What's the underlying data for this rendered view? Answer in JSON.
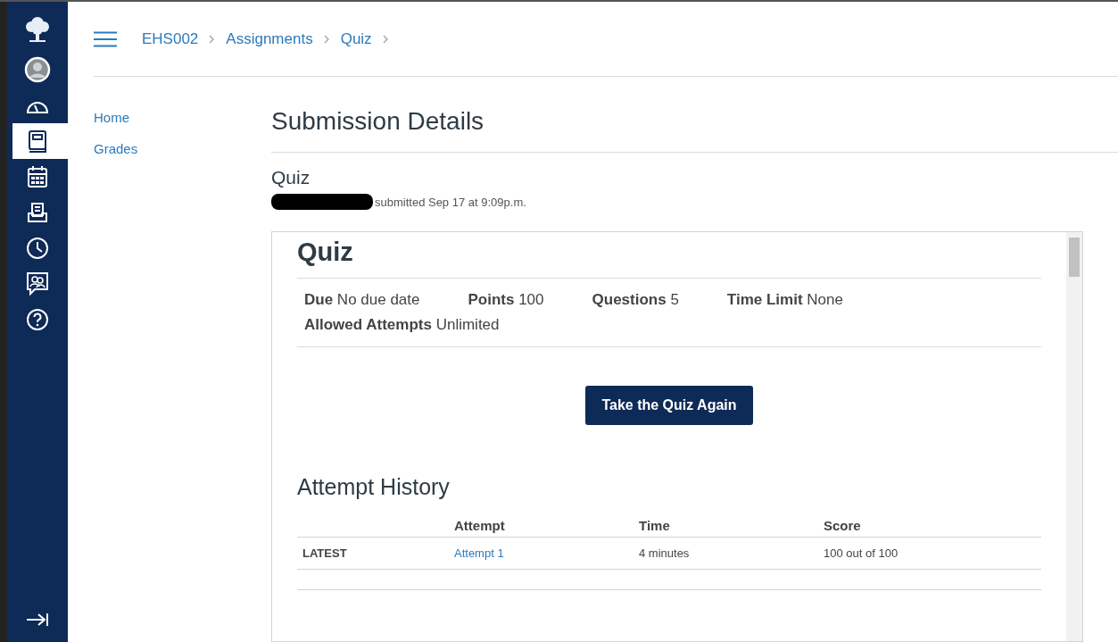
{
  "global_nav": {
    "items": [
      {
        "kind": "logo",
        "selected": false
      },
      {
        "kind": "account",
        "selected": false
      },
      {
        "kind": "dashboard",
        "selected": false
      },
      {
        "kind": "courses",
        "selected": true
      },
      {
        "kind": "calendar",
        "selected": false
      },
      {
        "kind": "inbox",
        "selected": false
      },
      {
        "kind": "history",
        "selected": false
      },
      {
        "kind": "commons",
        "selected": false
      },
      {
        "kind": "help",
        "selected": false
      }
    ],
    "collapse": {
      "kind": "collapse"
    }
  },
  "breadcrumbs": [
    "EHS002",
    "Assignments",
    "Quiz"
  ],
  "course_nav": [
    "Home",
    "Grades"
  ],
  "page_title": "Submission Details",
  "assignment_title": "Quiz",
  "submission_info": "submitted Sep 17 at 9:09p.m.",
  "quiz": {
    "title": "Quiz",
    "details": [
      {
        "label": "Due",
        "value": "No due date"
      },
      {
        "label": "Points",
        "value": "100"
      },
      {
        "label": "Questions",
        "value": "5"
      },
      {
        "label": "Time Limit",
        "value": "None"
      },
      {
        "label": "Allowed Attempts",
        "value": "Unlimited"
      }
    ],
    "button": "Take the Quiz Again",
    "history_title": "Attempt History",
    "table": {
      "columns": [
        "Attempt",
        "Time",
        "Score"
      ],
      "rows": [
        {
          "label": "LATEST",
          "attempt": "Attempt 1",
          "time": "4 minutes",
          "score": "100 out of 100"
        }
      ]
    }
  }
}
